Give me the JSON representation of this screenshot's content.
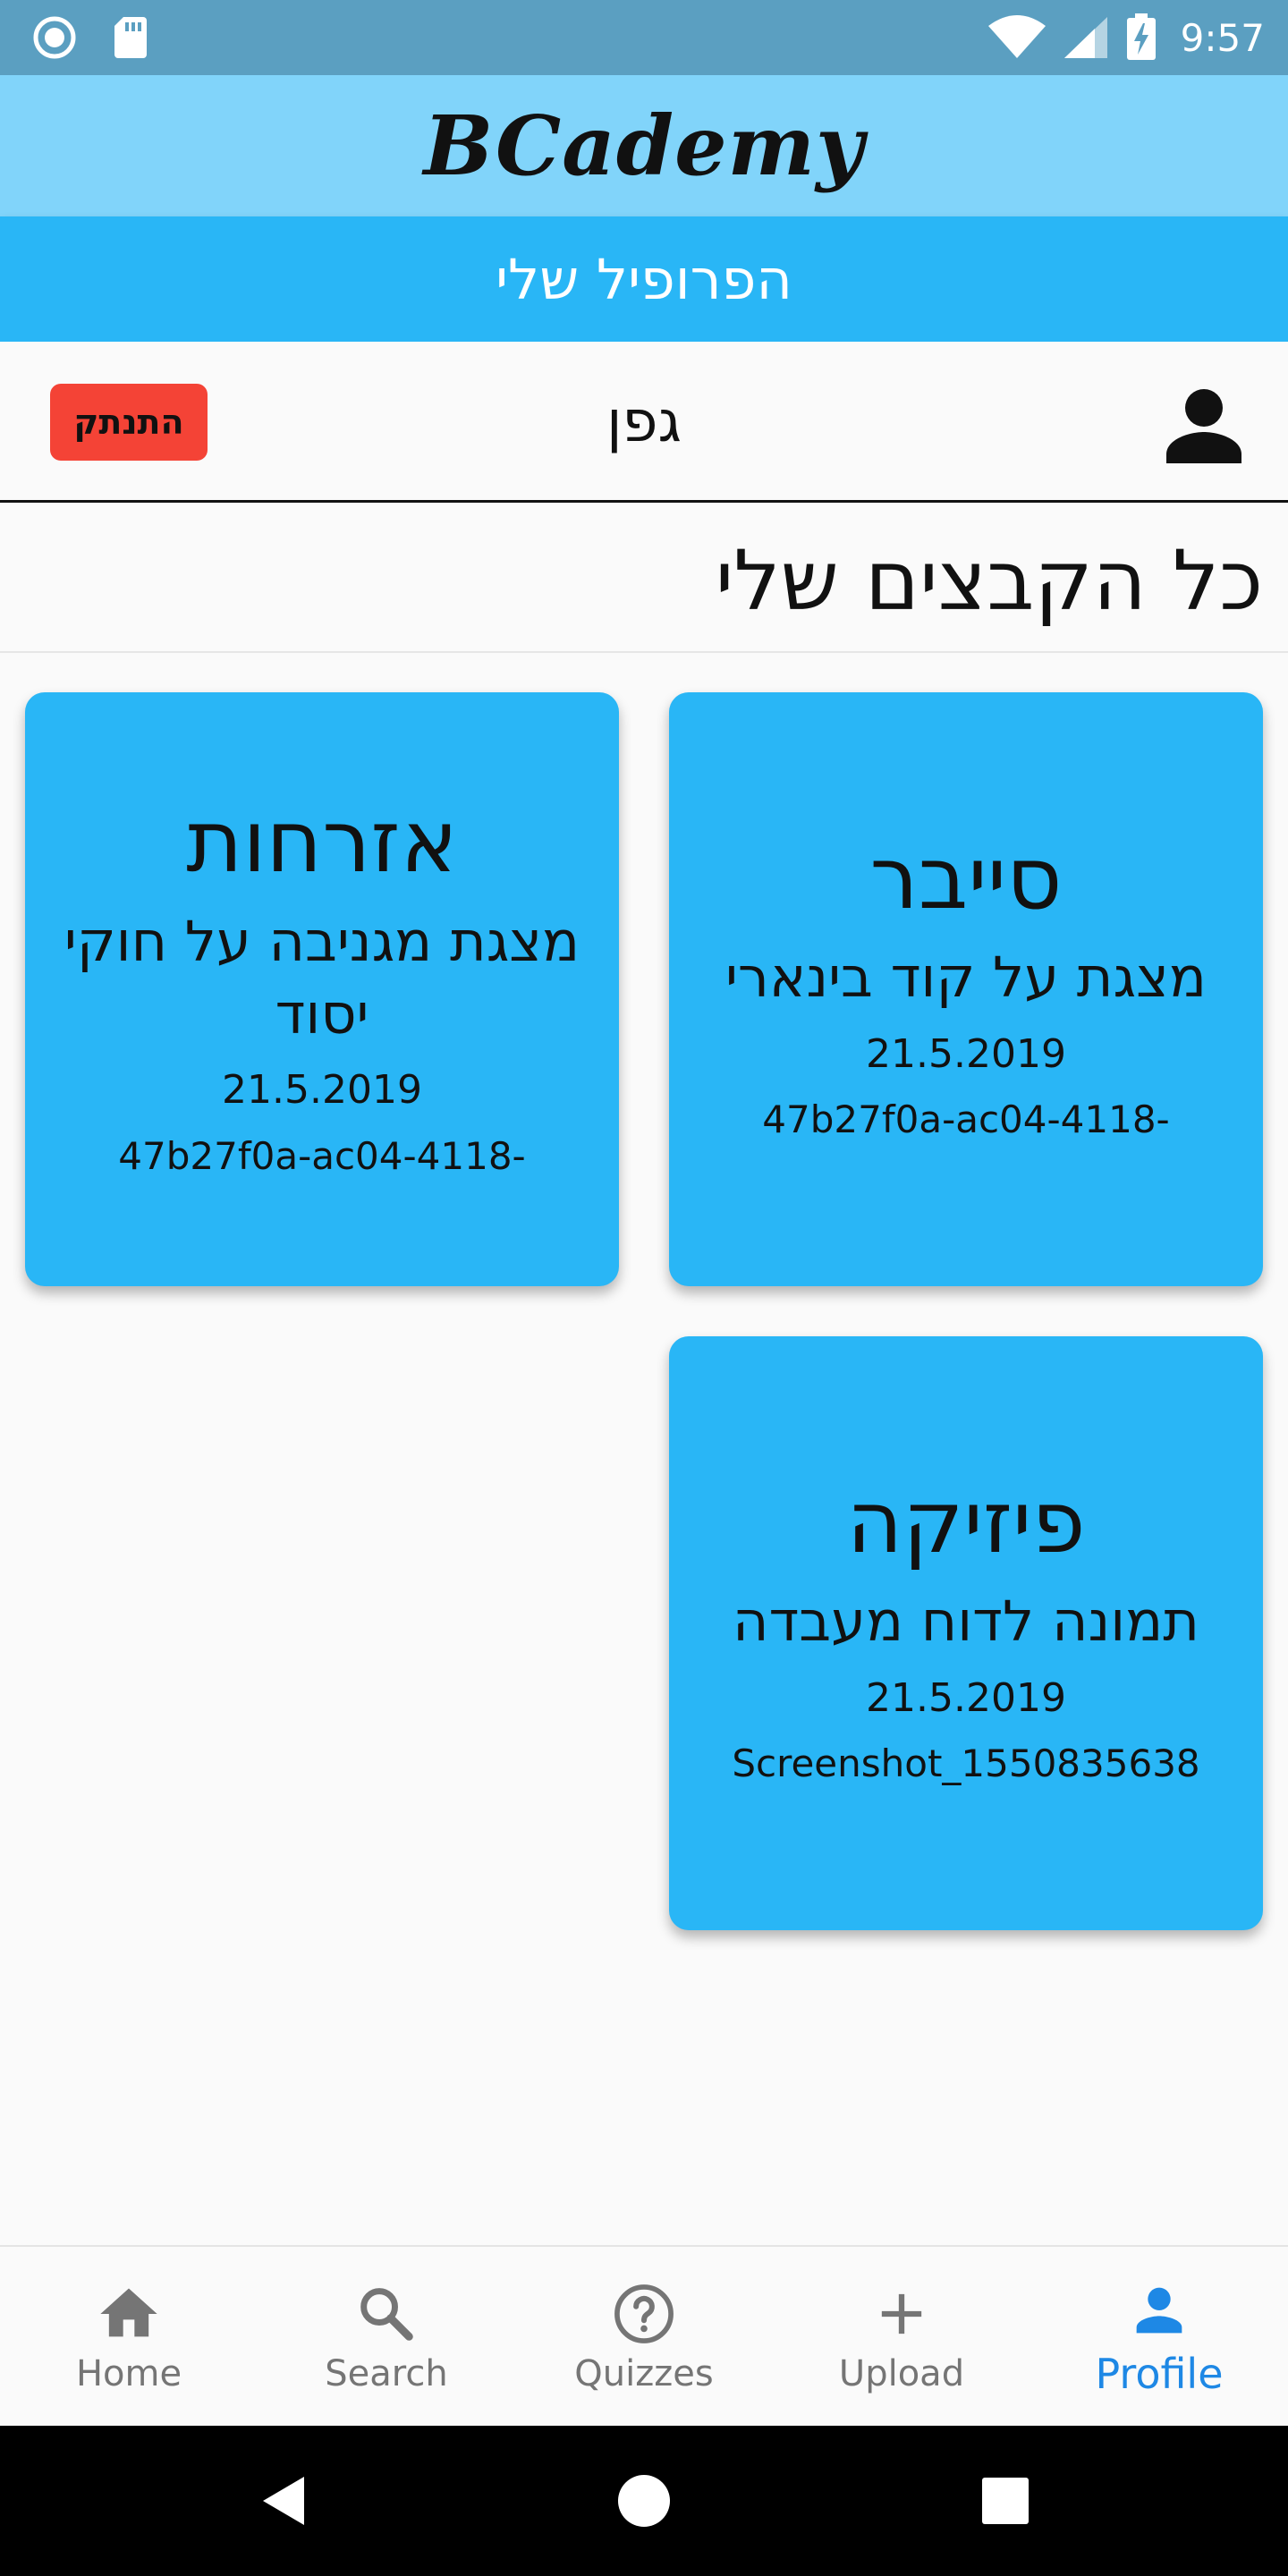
{
  "status_bar": {
    "time": "9:57",
    "left_icons": [
      "sync-circle-icon",
      "sd-card-icon"
    ],
    "right_icons": [
      "wifi-icon",
      "cellular-signal-icon",
      "battery-charging-icon"
    ]
  },
  "app_bar": {
    "title": "BCademy"
  },
  "page_header": {
    "title": "הפרופיל שלי"
  },
  "user": {
    "name": "גפן",
    "logout_label": "התנתק",
    "avatar_icon": "person-icon"
  },
  "files_section": {
    "title": "כל הקבצים שלי",
    "cards": [
      {
        "subject": "סייבר",
        "description": "מצגת על קוד בינארי",
        "date": "21.5.2019",
        "file": "47b27f0a-ac04-4118-"
      },
      {
        "subject": "אזרחות",
        "description": "מצגת מגניבה על חוקי יסוד",
        "date": "21.5.2019",
        "file": "47b27f0a-ac04-4118-"
      },
      {
        "subject": "פיזיקה",
        "description": "תמונה לדוח מעבדה",
        "date": "21.5.2019",
        "file": "Screenshot_1550835638"
      }
    ]
  },
  "bottom_nav": {
    "items": [
      {
        "label": "Home",
        "icon": "home-icon"
      },
      {
        "label": "Search",
        "icon": "search-icon"
      },
      {
        "label": "Quizzes",
        "icon": "help-circle-icon"
      },
      {
        "label": "Upload",
        "icon": "plus-icon"
      },
      {
        "label": "Profile",
        "icon": "person-icon"
      }
    ],
    "active": "Profile"
  },
  "system_nav": {
    "buttons": [
      "back-icon",
      "home-circle-icon",
      "recents-square-icon"
    ]
  },
  "colors": {
    "status_bar": "#5b9fc1",
    "app_bar": "#81d4fa",
    "header": "#29b6f6",
    "card": "#29b6f6",
    "logout": "#f44336",
    "nav_active": "#1e88e5",
    "nav_inactive": "#757575"
  }
}
